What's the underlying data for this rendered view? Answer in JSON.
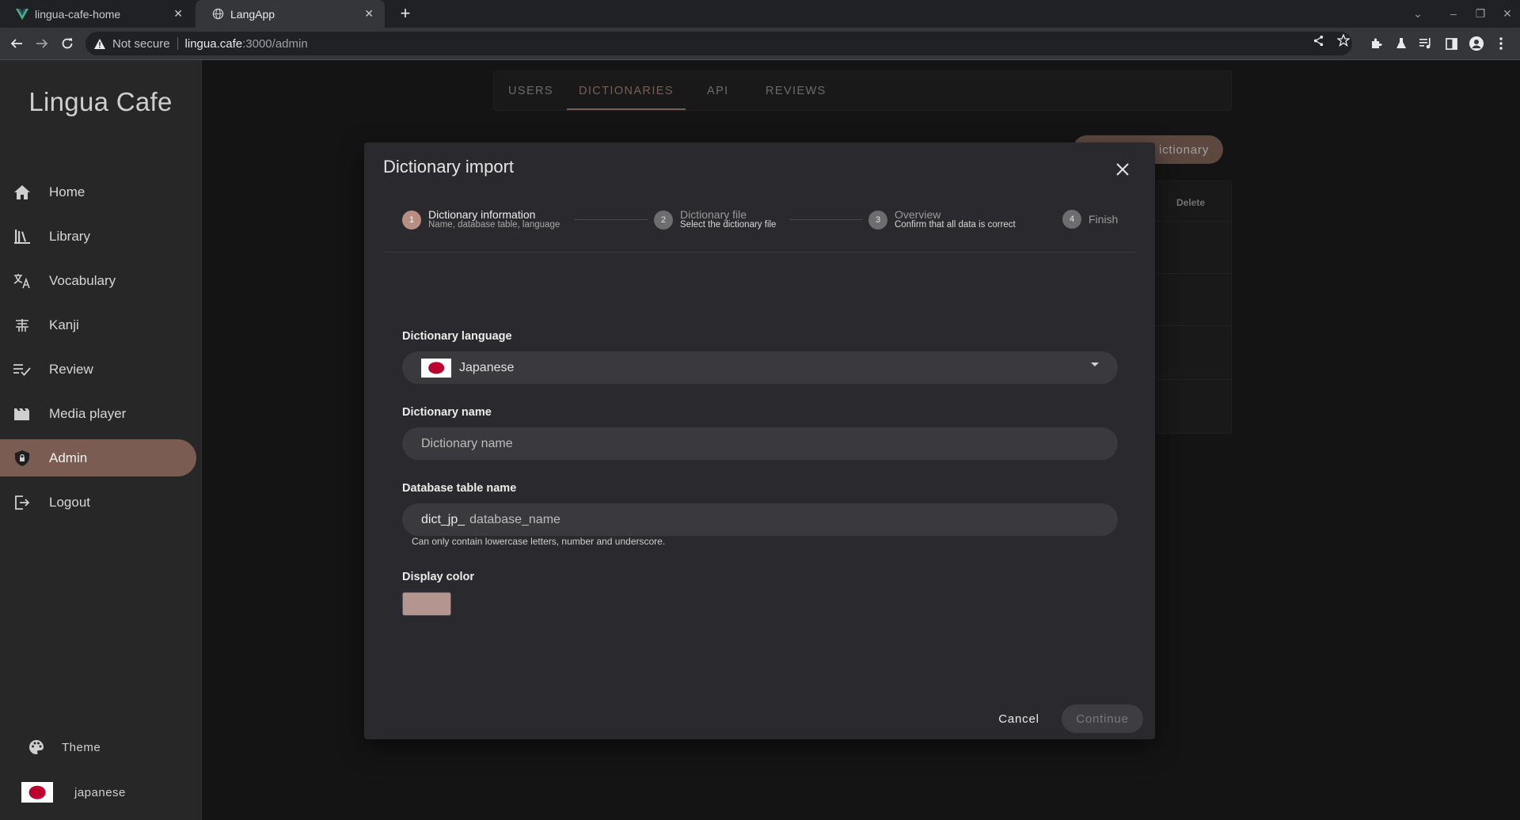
{
  "browser": {
    "tabs": [
      {
        "title": "lingua-cafe-home",
        "favicon": "vue-logo-icon",
        "active": false
      },
      {
        "title": "LangApp",
        "favicon": "globe-icon",
        "active": true
      }
    ],
    "omnibox": {
      "security": "Not secure",
      "host": "lingua.cafe",
      "rest": ":3000/admin"
    }
  },
  "sidebar": {
    "logo": "Lingua Cafe",
    "items": [
      {
        "label": "Home",
        "icon": "home-icon"
      },
      {
        "label": "Library",
        "icon": "library-icon"
      },
      {
        "label": "Vocabulary",
        "icon": "translate-icon"
      },
      {
        "label": "Kanji",
        "icon": "kanji-icon"
      },
      {
        "label": "Review",
        "icon": "review-icon"
      },
      {
        "label": "Media player",
        "icon": "video-icon"
      },
      {
        "label": "Admin",
        "icon": "shield-lock-icon",
        "active": true
      },
      {
        "label": "Logout",
        "icon": "logout-icon"
      }
    ],
    "theme_label": "Theme",
    "language_label": "japanese"
  },
  "admin": {
    "tabs": [
      "USERS",
      "DICTIONARIES",
      "API",
      "REVIEWS"
    ],
    "active_tab": "DICTIONARIES",
    "add_button_visible_text": "ictionary",
    "table_header_delete": "Delete"
  },
  "dialog": {
    "title": "Dictionary import",
    "steps": [
      {
        "number": "1",
        "title": "Dictionary information",
        "subtitle": "Name, database table, language",
        "active": true
      },
      {
        "number": "2",
        "title": "Dictionary file",
        "subtitle": "Select the dictionary file",
        "active": false
      },
      {
        "number": "3",
        "title": "Overview",
        "subtitle": "Confirm that all data is correct",
        "active": false
      },
      {
        "number": "4",
        "title": "Finish",
        "subtitle": "",
        "active": false
      }
    ],
    "language": {
      "label": "Dictionary language",
      "value": "Japanese"
    },
    "name": {
      "label": "Dictionary name",
      "placeholder": "Dictionary name"
    },
    "table": {
      "label": "Database table name",
      "prefix": "dict_jp_",
      "placeholder": "database_name",
      "hint": "Can only contain lowercase letters, number and underscore."
    },
    "color": {
      "label": "Display color",
      "value": "#b49590"
    },
    "cancel_label": "Cancel",
    "continue_label": "Continue"
  },
  "colors": {
    "accent": "#b88e82",
    "active_nav": "#7a5c53"
  }
}
